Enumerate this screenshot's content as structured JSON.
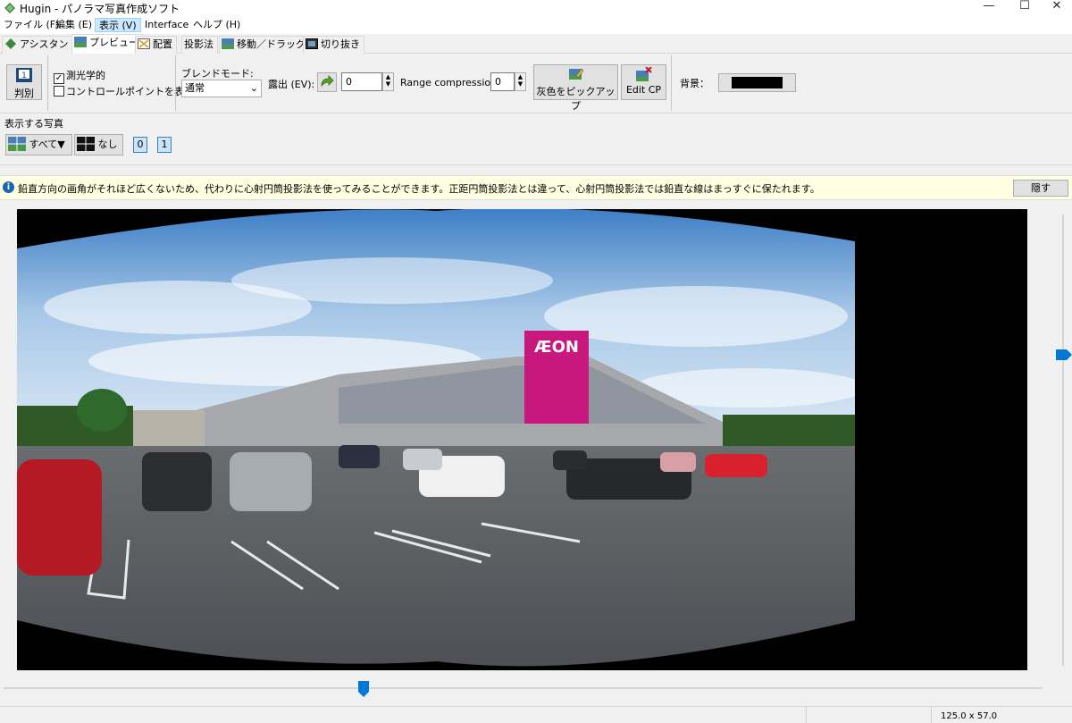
{
  "window": {
    "title": "Hugin - パノラマ写真作成ソフト",
    "controls": [
      "—",
      "☐",
      "✕"
    ]
  },
  "menu": [
    {
      "label": "ファイル (F)"
    },
    {
      "label": "編集 (E)"
    },
    {
      "label": "表示 (V)"
    },
    {
      "label": "Interface"
    },
    {
      "label": "ヘルプ (H)"
    }
  ],
  "tabs": [
    {
      "label": "アシスタント"
    },
    {
      "label": "プレビュー"
    },
    {
      "label": "配置"
    },
    {
      "label": "投影法"
    },
    {
      "label": "移動／ドラッグ"
    },
    {
      "label": "切り抜き"
    }
  ],
  "toolbar": {
    "identify_label": "判別",
    "photometric_label": "測光学的",
    "photometric_checked": "✓",
    "show_cp_label": "コントロールポイントを表示",
    "blend_mode_label": "ブレンドモード:",
    "blend_mode_value": "通常",
    "exposure_label": "露出 (EV):",
    "exposure_value": "0",
    "range_label": "Range compression:",
    "range_value": "0",
    "pick_gray_label": "灰色をピックアップ",
    "edit_cp_label": "Edit CP",
    "background_label": "背景："
  },
  "images": {
    "section_label": "表示する写真",
    "all_label": "すべて▼",
    "none_label": "なし",
    "image_buttons": [
      "0",
      "1"
    ]
  },
  "info": {
    "message": "鉛直方向の画角がそれほど広くないため、代わりに心射円筒投影法を使ってみることができます。正距円筒投影法とは違って、心射円筒投影法では鉛直な線はまっすぐに保たれます。",
    "hide_label": "隠す"
  },
  "preview": {
    "sign_text": "ÆON"
  },
  "status": {
    "fov": "125.0 x 57.0"
  }
}
